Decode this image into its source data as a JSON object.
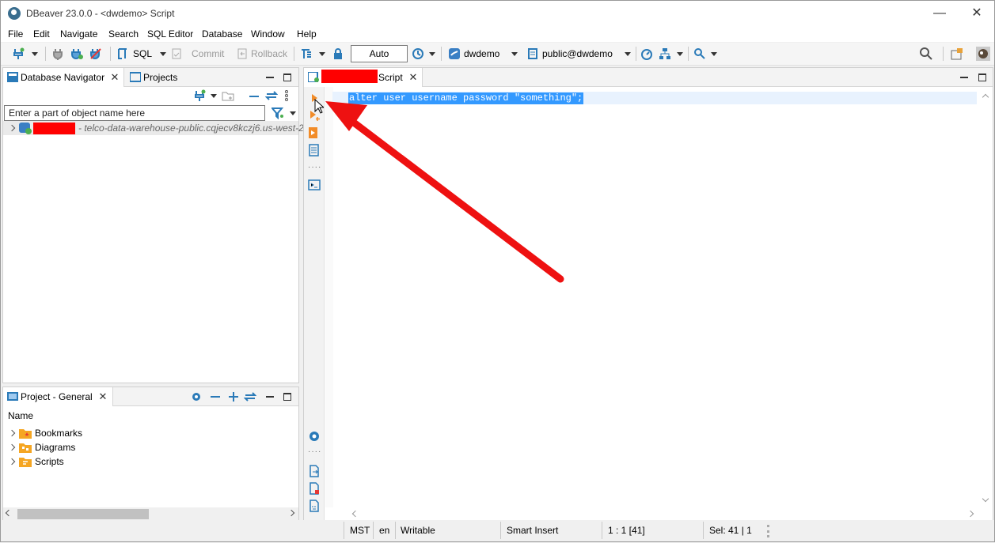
{
  "window": {
    "title": "DBeaver 23.0.0 - <dwdemo> Script",
    "minimize": "—",
    "maximize": "☐",
    "close": "✕"
  },
  "menu": {
    "items": [
      "File",
      "Edit",
      "Navigate",
      "Search",
      "SQL Editor",
      "Database",
      "Window",
      "Help"
    ]
  },
  "toolbar": {
    "sql_label": "SQL",
    "commit_label": "Commit",
    "rollback_label": "Rollback",
    "transaction_mode": "Auto",
    "datasource": "dwdemo",
    "schema": "public@dwdemo"
  },
  "navigator": {
    "tab_label": "Database Navigator",
    "projects_tab_label": "Projects",
    "filter_placeholder": "Enter a part of object name here",
    "connection_description": "- telco-data-warehouse-public.cqjecv8kczj6.us-west-2"
  },
  "project_panel": {
    "tab_label": "Project - General",
    "column_header": "Name",
    "items": [
      {
        "label": "Bookmarks",
        "icon": "bookmark-folder-icon"
      },
      {
        "label": "Diagrams",
        "icon": "diagram-folder-icon"
      },
      {
        "label": "Scripts",
        "icon": "script-folder-icon"
      }
    ]
  },
  "editor": {
    "tab_label": "Script",
    "code": "alter user username password \"something\";"
  },
  "status": {
    "timezone": "MST",
    "locale": "en",
    "mode": "Writable",
    "insert_mode": "Smart Insert",
    "cursor": "1 : 1 [41]",
    "selection": "Sel: 41 | 1"
  },
  "colors": {
    "accent": "#3399ff",
    "annotation_arrow": "#ee1111",
    "redaction": "#ff0000"
  }
}
